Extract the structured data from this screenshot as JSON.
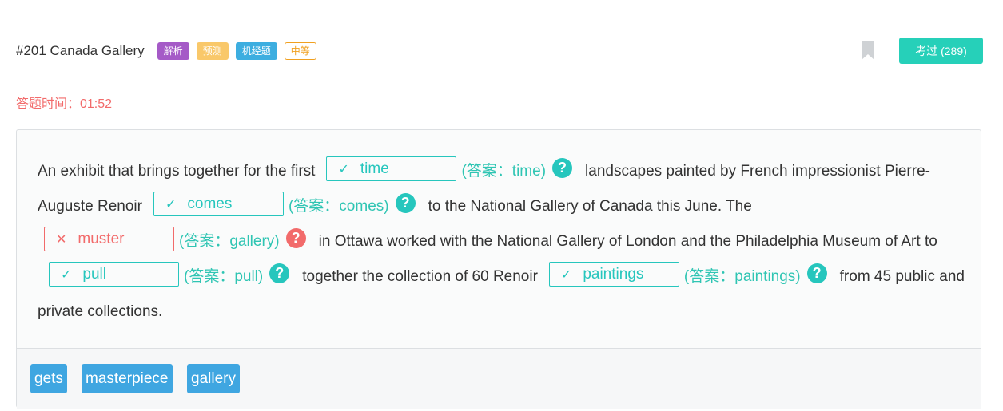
{
  "header": {
    "title": "#201 Canada Gallery",
    "tags": {
      "jiexi": "解析",
      "yuce": "预测",
      "jijing": "机经题",
      "level": "中等"
    },
    "exam_button": "考过 (289)"
  },
  "timer": "答题时间：01:52",
  "passage": {
    "s1": "An exhibit that brings together for the first",
    "b1": {
      "mark": "✓",
      "value": "time",
      "answer": "(答案：time)"
    },
    "s2": "landscapes painted by French impressionist Pierre-Auguste Renoir",
    "b2": {
      "mark": "✓",
      "value": "comes",
      "answer": "(答案：comes)"
    },
    "s3": "to the National Gallery of Canada this June. The",
    "b3": {
      "mark": "✕",
      "value": "muster",
      "answer": "(答案：gallery)"
    },
    "s4": "in Ottawa worked with the National Gallery of London and the Philadelphia Museum of Art to",
    "b4": {
      "mark": "✓",
      "value": "pull",
      "answer": "(答案：pull)"
    },
    "s5": "together the collection of 60 Renoir",
    "b5": {
      "mark": "✓",
      "value": "paintings",
      "answer": "(答案：paintings)"
    },
    "s6": "from 45 public and private collections.",
    "help_symbol": "?"
  },
  "options": [
    "gets",
    "masterpiece",
    "gallery"
  ],
  "colors": {
    "accent": "#26c6bd",
    "wrong": "#f26b6b",
    "option": "#3fa6e1"
  }
}
